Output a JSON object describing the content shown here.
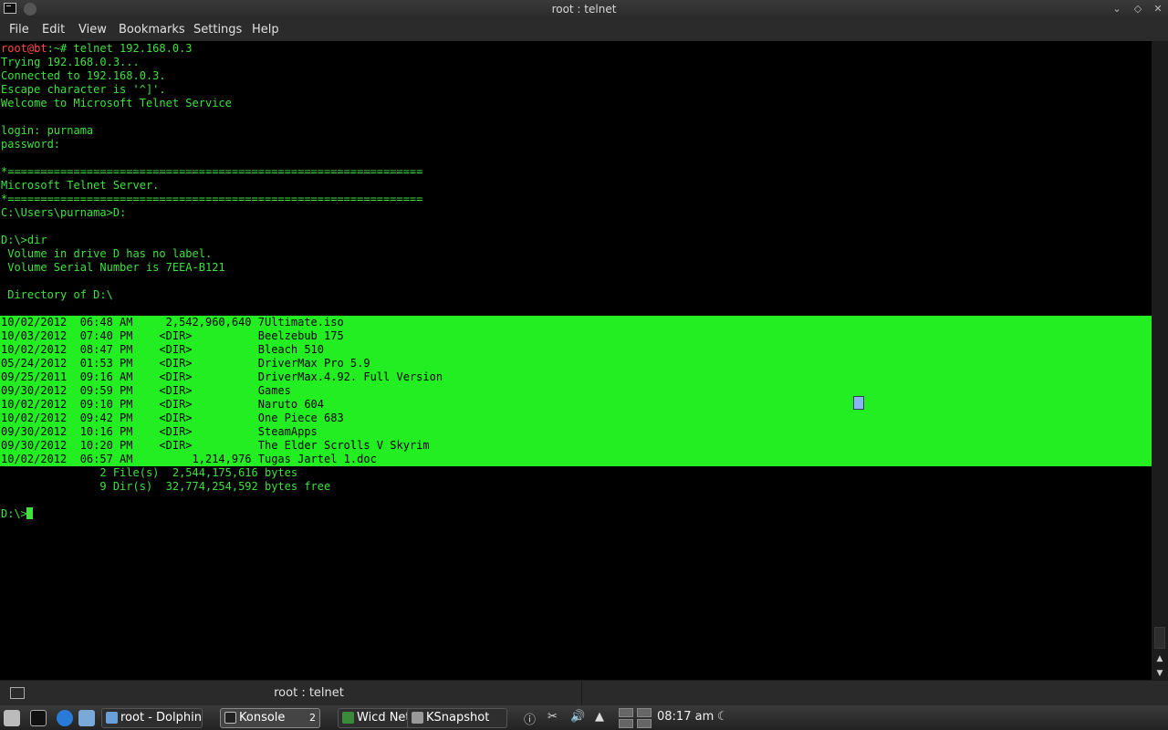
{
  "window": {
    "title": "root : telnet"
  },
  "menu": [
    "File",
    "Edit",
    "View",
    "Bookmarks",
    "Settings",
    "Help"
  ],
  "terminal": {
    "prompt_user": "root@bt",
    "prompt_rest": ":~# telnet 192.168.0.3",
    "lines_before": [
      "Trying 192.168.0.3...",
      "Connected to 192.168.0.3.",
      "Escape character is '^]'.",
      "Welcome to Microsoft Telnet Service",
      "",
      "login: purnama",
      "password:",
      "",
      "*===============================================================",
      "Microsoft Telnet Server.",
      "*===============================================================",
      "C:\\Users\\purnama>D:",
      "",
      "D:\\>dir",
      " Volume in drive D has no label.",
      " Volume Serial Number is 7EEA-B121",
      "",
      " Directory of D:\\",
      ""
    ],
    "listing": [
      "10/02/2012  06:48 AM     2,542,960,640 7Ultimate.iso",
      "10/03/2012  07:40 PM    <DIR>          Beelzebub 175",
      "10/02/2012  08:47 PM    <DIR>          Bleach 510",
      "05/24/2012  01:53 PM    <DIR>          DriverMax Pro 5.9",
      "09/25/2011  09:16 AM    <DIR>          DriverMax.4.92. Full Version",
      "09/30/2012  09:59 PM    <DIR>          Games",
      "10/02/2012  09:10 PM    <DIR>          Naruto 604",
      "10/02/2012  09:42 PM    <DIR>          One Piece 683",
      "09/30/2012  10:16 PM    <DIR>          SteamApps",
      "09/30/2012  10:20 PM    <DIR>          The Elder Scrolls V Skyrim",
      "10/02/2012  06:57 AM         1,214,976 Tugas Jartel 1.doc"
    ],
    "lines_after": [
      "               2 File(s)  2,544,175,616 bytes",
      "               9 Dir(s)  32,774,254,592 bytes free",
      "",
      "D:\\>"
    ]
  },
  "tab": {
    "label": "root : telnet"
  },
  "taskbar": {
    "tasks": [
      {
        "label": "root - Dolphin"
      },
      {
        "label": "Konsole",
        "count": "2"
      },
      {
        "label": "Wicd Network..."
      },
      {
        "label": "KSnapshot"
      }
    ],
    "clock": "08:17 am"
  },
  "colors": {
    "terminal_fg": "#3de23d",
    "highlight_bg": "#22ee22",
    "prompt_user": "#ff4a4a"
  }
}
